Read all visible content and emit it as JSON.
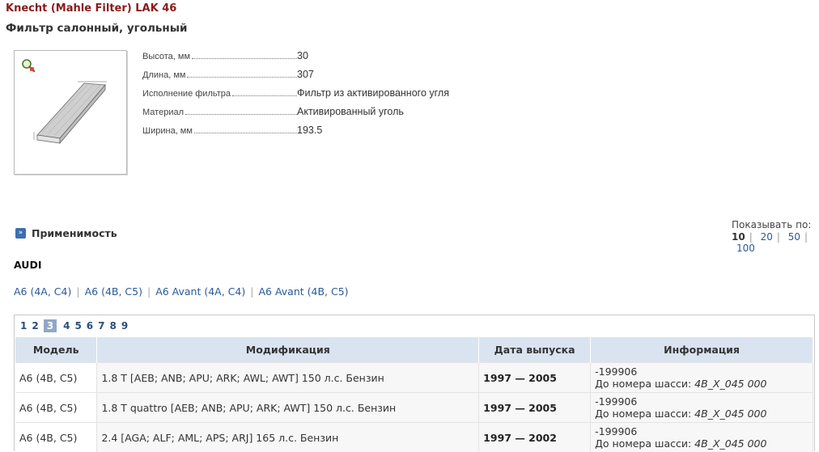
{
  "product": {
    "title": "Knecht (Mahle Filter) LAK 46",
    "subtitle": "Фильтр салонный, угольный"
  },
  "specs": [
    {
      "label": "Высота, мм",
      "value": "30"
    },
    {
      "label": "Длина, мм",
      "value": "307"
    },
    {
      "label": "Исполнение фильтра",
      "value": "Фильтр из активированного угля"
    },
    {
      "label": "Материал",
      "value": "Активированный уголь"
    },
    {
      "label": "Ширина, мм",
      "value": "193.5"
    }
  ],
  "applicability": {
    "title": "Применимость",
    "icon": "double-chevron-right-icon"
  },
  "per_page": {
    "label": "Показывать по:",
    "current": "10",
    "options": [
      "20",
      "50",
      "100"
    ]
  },
  "brand": "AUDI",
  "models": [
    "A6 (4A, C4)",
    "A6 (4B, C5)",
    "A6 Avant (4A, C4)",
    "A6 Avant (4B, C5)"
  ],
  "pager": {
    "pages": [
      "1",
      "2",
      "3",
      "4",
      "5",
      "6",
      "7",
      "8",
      "9"
    ],
    "active": "3"
  },
  "table": {
    "headers": [
      "Модель",
      "Модификация",
      "Дата выпуска",
      "Информация"
    ],
    "rows": [
      {
        "model": "A6 (4B, C5)",
        "mod": "1.8 T [AEB; ANB; APU; ARK; AWL; AWT] 150 л.с. Бензин",
        "date": "1997 — 2005",
        "info1": "-199906",
        "info2_label": "До номера шасси:",
        "info2_value": "4B_X_045 000"
      },
      {
        "model": "A6 (4B, C5)",
        "mod": "1.8 T quattro [AEB; ANB; APU; ARK; AWT] 150 л.с. Бензин",
        "date": "1997 — 2005",
        "info1": "-199906",
        "info2_label": "До номера шасси:",
        "info2_value": "4B_X_045 000"
      },
      {
        "model": "A6 (4B, C5)",
        "mod": "2.4 [AGA; ALF; AML; APS; ARJ] 165 л.с. Бензин",
        "date": "1997 — 2002",
        "info1": "-199906",
        "info2_label": "До номера шасси:",
        "info2_value": "4B_X_045 000"
      }
    ]
  },
  "colors": {
    "title": "#8b1a1a",
    "link": "#2a5a9a",
    "header_bg": "#d9e4f0"
  }
}
